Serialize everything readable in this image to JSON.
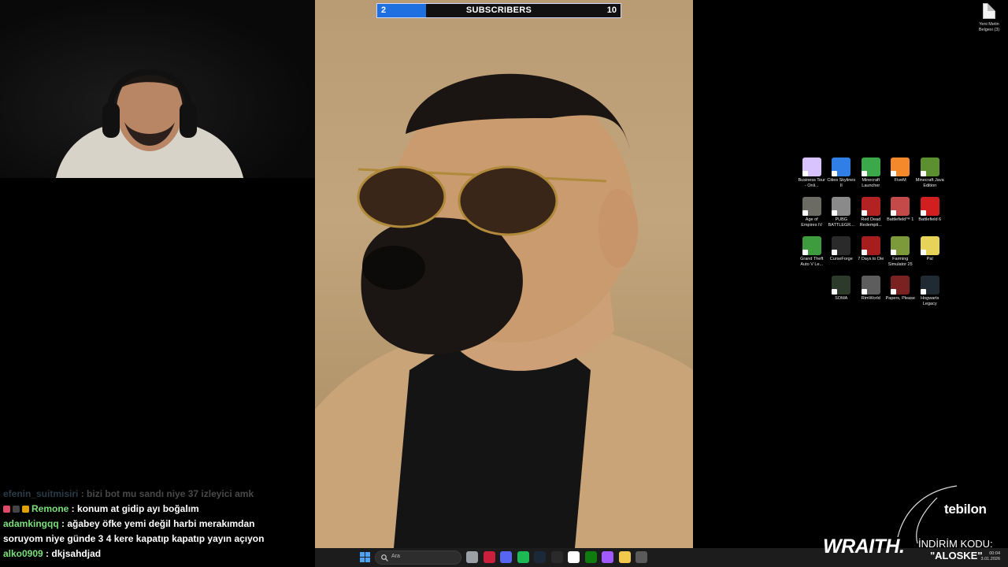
{
  "subscribers": {
    "current": "2",
    "label": "SUBSCRIBERS",
    "goal": "10",
    "progress_fraction": 0.2,
    "bar_color": "#1e6fe0"
  },
  "desktop": {
    "top_file": {
      "label": "Yeni Metin Belgesi (3)",
      "icon": "text-file-icon"
    },
    "icons": [
      {
        "name": "Business Tour - Onli...",
        "color": "#d9c3ff"
      },
      {
        "name": "Cities Skylines II",
        "color": "#2f7fe6"
      },
      {
        "name": "Minecraft Launcher",
        "color": "#3ba84a"
      },
      {
        "name": "FiveM",
        "color": "#f4892c"
      },
      {
        "name": "Minecraft Java Edition",
        "color": "#5b8f2f"
      },
      {
        "name": "Age of Empires IV",
        "color": "#6b6a63"
      },
      {
        "name": "PUBG BATTLEGR...",
        "color": "#8a8a8a"
      },
      {
        "name": "Red Dead Redempti...",
        "color": "#b22222"
      },
      {
        "name": "Battlefield™ 1",
        "color": "#c44a4a"
      },
      {
        "name": "Battlefield 6",
        "color": "#d11f1f"
      },
      {
        "name": "Grand Theft Auto V Le...",
        "color": "#3e9b3e"
      },
      {
        "name": "CurseForge",
        "color": "#2a2a2a"
      },
      {
        "name": "7 Days to Die",
        "color": "#a51d1d"
      },
      {
        "name": "Farming Simulator 25",
        "color": "#7c9a3a"
      },
      {
        "name": "Pal",
        "color": "#e8d35a"
      },
      {
        "name": "",
        "color": ""
      },
      {
        "name": "SOMA",
        "color": "#2c3a2c"
      },
      {
        "name": "RimWorld",
        "color": "#5d5d5d"
      },
      {
        "name": "Papers, Please",
        "color": "#7a2121"
      },
      {
        "name": "Hogwarts Legacy",
        "color": "#1f2a33"
      }
    ]
  },
  "chat": [
    {
      "user": "efenin_suitmisiri",
      "user_color": "#8fd3ff",
      "msg": "bizi bot mu sandı niye 37 izleyici amk",
      "faded": true,
      "badges": []
    },
    {
      "user": "Remone",
      "user_color": "#7ae07a",
      "msg": "konum at gidip ayı boğalım",
      "faded": false,
      "badges": [
        "#e04a6a",
        "#444",
        "#e0a000"
      ]
    },
    {
      "user": "adamkingqq",
      "user_color": "#7ae07a",
      "msg": "ağabey öfke yemi değil harbi merakımdan",
      "faded": false,
      "badges": []
    },
    {
      "user": "",
      "user_color": "#ffffff",
      "msg": "soruyom niye günde 3 4 kere kapatıp kapatıp yayın açıyon",
      "faded": false,
      "badges": []
    },
    {
      "user": "alko0909",
      "user_color": "#7ae07a",
      "msg": "dkjsahdjad",
      "faded": false,
      "badges": []
    }
  ],
  "taskbar": {
    "search_placeholder": "Ara",
    "icons": [
      "start-icon",
      "task-view-icon",
      "opera-gx-icon",
      "discord-icon",
      "spotify-icon",
      "steam-icon",
      "epic-games-icon",
      "capcut-icon",
      "xbox-icon",
      "figma-icon",
      "file-explorer-icon",
      "obs-icon"
    ],
    "clock_time": "00:04",
    "clock_date": "3.01.2026"
  },
  "sponsor": {
    "brand": "tebilon",
    "product": "WRAITH.",
    "discount_label": "İNDİRİM KODU:",
    "code": "\"ALOSKE\""
  }
}
